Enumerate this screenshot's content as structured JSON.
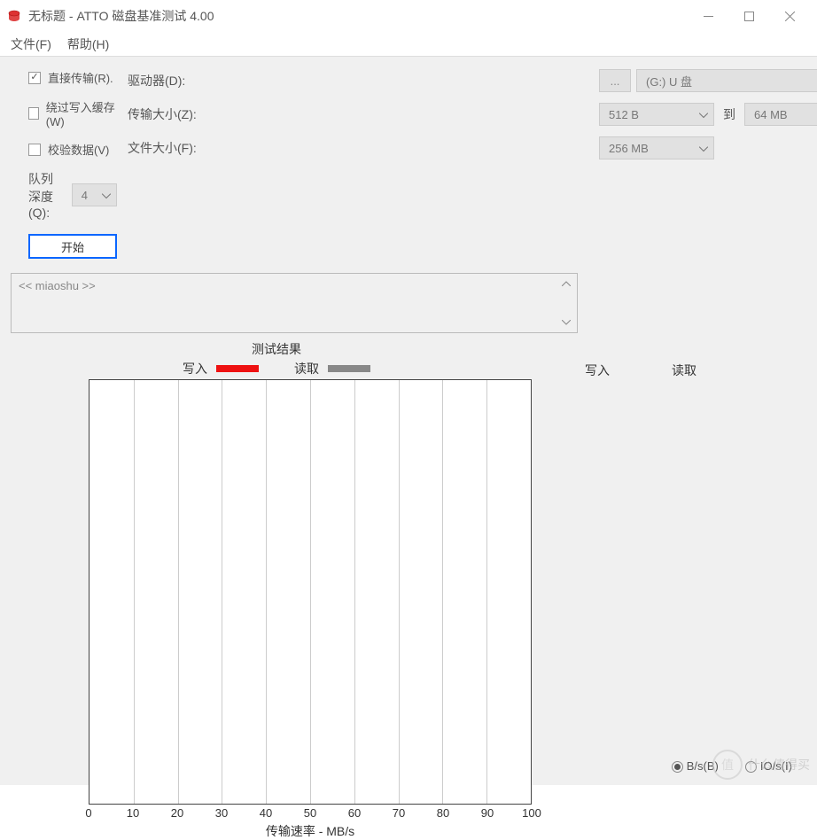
{
  "window": {
    "title": "无标题 - ATTO 磁盘基准测试 4.00"
  },
  "menu": {
    "file": "文件(F)",
    "help": "帮助(H)"
  },
  "form": {
    "drive_label": "驱动器(D):",
    "ellipsis": "...",
    "drive_value": "(G:) U 盘",
    "transfer_size_label": "传输大小(Z):",
    "transfer_from": "512 B",
    "to_label": "到",
    "transfer_to": "64 MB",
    "file_size_label": "文件大小(F):",
    "file_size_value": "256 MB"
  },
  "options": {
    "direct_io": {
      "label": "直接传输(R).",
      "checked": true
    },
    "bypass_cache": {
      "label": "绕过写入缓存(W)",
      "checked": false
    },
    "verify_data": {
      "label": "校验数据(V)",
      "checked": false
    },
    "queue_depth_label": "队列深度(Q):",
    "queue_depth_value": "4",
    "start_button": "开始"
  },
  "desc": {
    "text": "<< miaoshu >>"
  },
  "results": {
    "title": "测试结果",
    "legend": {
      "write": "写入",
      "read": "读取"
    },
    "xaxis_label": "传输速率 - MB/s",
    "data_headers": {
      "write": "写入",
      "read": "读取"
    }
  },
  "chart_data": {
    "type": "bar",
    "title": "测试结果",
    "xlabel": "传输速率 - MB/s",
    "ylabel": "",
    "xlim": [
      0,
      100
    ],
    "x_ticks": [
      0,
      10,
      20,
      30,
      40,
      50,
      60,
      70,
      80,
      90,
      100
    ],
    "categories": [],
    "series": [
      {
        "name": "写入",
        "color": "#e11",
        "values": []
      },
      {
        "name": "读取",
        "color": "#888",
        "values": []
      }
    ]
  },
  "footer": {
    "unit_bs": "B/s(B)",
    "unit_ios": "IO/s(I)",
    "selected": "B/s(B)"
  },
  "watermark": {
    "badge": "值",
    "text": "什么值得买"
  }
}
